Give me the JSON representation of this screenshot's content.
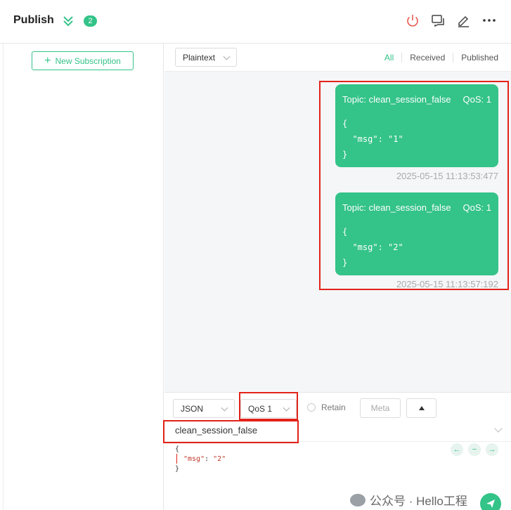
{
  "header": {
    "title": "Publish",
    "badge_count": "2",
    "icons": [
      "disconnect-icon",
      "chat-icon",
      "edit-icon",
      "more-icon"
    ]
  },
  "sidebar": {
    "new_subscription_label": "New Subscription"
  },
  "messages": {
    "format_select": "Plaintext",
    "filters": [
      "All",
      "Received",
      "Published"
    ],
    "items": [
      {
        "topic": "Topic: clean_session_false",
        "qos": "QoS: 1",
        "payload": "{\n  \"msg\": \"1\"\n}",
        "time": "2025-05-15 11:13:53:477"
      },
      {
        "topic": "Topic: clean_session_false",
        "qos": "QoS: 1",
        "payload": "{\n  \"msg\": \"2\"\n}",
        "time": "2025-05-15 11:13:57:192"
      }
    ]
  },
  "composer": {
    "payload_format": "JSON",
    "qos": "QoS 1",
    "retain_label": "Retain",
    "meta_label": "Meta",
    "topic": "clean_session_false",
    "payload_line1": "{",
    "payload_key": "\"msg\"",
    "payload_sep": ": ",
    "payload_value": "\"2\"",
    "payload_line3": "}"
  },
  "watermark": {
    "text": "公众号 · Hello工程"
  },
  "colors": {
    "accent": "#34c388",
    "highlight": "#e2231a"
  }
}
